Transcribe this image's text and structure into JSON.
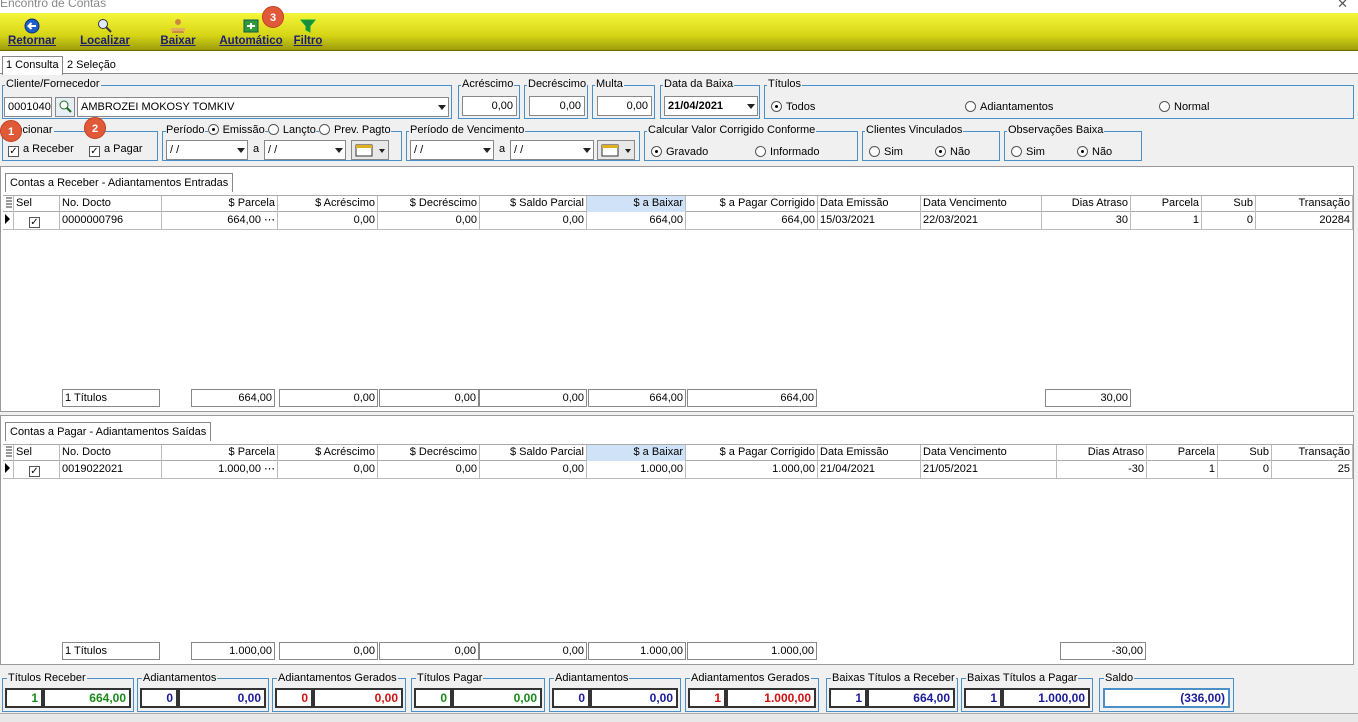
{
  "window": {
    "title": "Encontro de Contas",
    "close_glyph": "✕"
  },
  "toolbar": {
    "buttons": [
      {
        "label": "Retornar",
        "icon": "back-arrow-icon"
      },
      {
        "label": "Localizar",
        "icon": "search-icon"
      },
      {
        "label": "Baixar",
        "icon": "person-icon"
      },
      {
        "label": "Automático",
        "icon": "auto-icon"
      },
      {
        "label": "Filtro",
        "icon": "funnel-icon"
      }
    ],
    "badge": "3"
  },
  "tabs": [
    "1 Consulta",
    "2 Seleção"
  ],
  "filters": {
    "cliente_label": "Cliente/Fornecedor",
    "cliente_code": "0001040",
    "cliente_name": "AMBROZEI MOKOSY TOMKIV",
    "acrescimo_label": "Acréscimo",
    "acrescimo_value": "0,00",
    "decrescimo_label": "Decréscimo",
    "decrescimo_value": "0,00",
    "multa_label": "Multa",
    "multa_value": "0,00",
    "data_baixa_label": "Data da Baixa",
    "data_baixa_value": "21/04/2021",
    "titulos_label": "Títulos",
    "titulos_options": [
      "Todos",
      "Adiantamentos",
      "Normal"
    ],
    "titulos_selected": "Todos",
    "selecionar_label": "lecionar",
    "selecionar_badge": "1",
    "selecionar_badge2": "2",
    "check_receber": "a Receber",
    "check_pagar": "a Pagar",
    "periodo_label": "Período",
    "periodo_options": [
      "Emissão",
      "Lançto",
      "Prev. Pagto"
    ],
    "periodo_from": " / /",
    "periodo_a": "a",
    "periodo_to": " / /",
    "venc_label": "Período de Vencimento",
    "venc_from": " / /",
    "venc_a": "a",
    "venc_to": " / /",
    "calc_label": "Calcular Valor Corrigido Conforme",
    "calc_options": [
      "Gravado",
      "Informado"
    ],
    "clientes_vinc_label": "Clientes Vinculados",
    "clientes_vinc_options": [
      "Sim",
      "Não"
    ],
    "obs_label": "Observações Baixa",
    "obs_options": [
      "Sim",
      "Não"
    ]
  },
  "receber": {
    "tab": "Contas a Receber - Adiantamentos Entradas",
    "headers": [
      "Sel",
      "No. Docto",
      "$ Parcela",
      "$ Acréscimo",
      "$ Decréscimo",
      "$ Saldo Parcial",
      "$ a Baixar",
      "$ a Pagar Corrigido",
      "Data Emissão",
      "Data Vencimento",
      "Dias Atraso",
      "Parcela",
      "Sub",
      "Transação"
    ],
    "row": [
      "✓",
      "0000000796",
      "664,00 ⋯",
      "0,00",
      "0,00",
      "0,00",
      "664,00",
      "664,00",
      "15/03/2021",
      "22/03/2021",
      "30",
      "1",
      "0",
      "20284"
    ],
    "footer": [
      "1 Títulos",
      "664,00",
      "0,00",
      "0,00",
      "0,00",
      "664,00",
      "664,00",
      "30,00"
    ]
  },
  "pagar": {
    "tab": "Contas a Pagar - Adiantamentos Saídas",
    "headers": [
      "Sel",
      "No. Docto",
      "$ Parcela",
      "$ Acréscimo",
      "$ Decréscimo",
      "$ Saldo Parcial",
      "$ a Baixar",
      "$ a Pagar Corrigido",
      "Data Emissão",
      "Data Vencimento",
      "Dias Atraso",
      "Parcela",
      "Sub",
      "Transação"
    ],
    "row": [
      "✓",
      "0019022021",
      "1.000,00 ⋯",
      "0,00",
      "0,00",
      "0,00",
      "1.000,00",
      "1.000,00",
      "21/04/2021",
      "21/05/2021",
      "-30",
      "1",
      "0",
      "25"
    ],
    "footer": [
      "1 Títulos",
      "1.000,00",
      "0,00",
      "0,00",
      "0,00",
      "1.000,00",
      "1.000,00",
      "-30,00"
    ]
  },
  "summary": [
    {
      "label": "Títulos Receber",
      "count": "1",
      "value": "664,00",
      "color": "#1a8a1a"
    },
    {
      "label": "Adiantamentos",
      "count": "0",
      "value": "0,00",
      "color": "#1a1a9a"
    },
    {
      "label": "Adiantamentos Gerados",
      "count": "0",
      "value": "0,00",
      "color": "#d01010"
    },
    {
      "label": "Títulos Pagar",
      "count": "0",
      "value": "0,00",
      "color": "#1a8a1a"
    },
    {
      "label": "Adiantamentos",
      "count": "0",
      "value": "0,00",
      "color": "#1a1a9a"
    },
    {
      "label": "Adiantamentos Gerados",
      "count": "1",
      "value": "1.000,00",
      "color": "#d01010"
    },
    {
      "label": "Baixas Títulos a Receber",
      "count": "1",
      "value": "664,00",
      "color": "#1a1a9a"
    },
    {
      "label": "Baixas Títulos a Pagar",
      "count": "1",
      "value": "1.000,00",
      "color": "#1a1a9a"
    }
  ],
  "saldo": {
    "label": "Saldo",
    "value": "(336,00)",
    "color": "#1a1a9a"
  }
}
